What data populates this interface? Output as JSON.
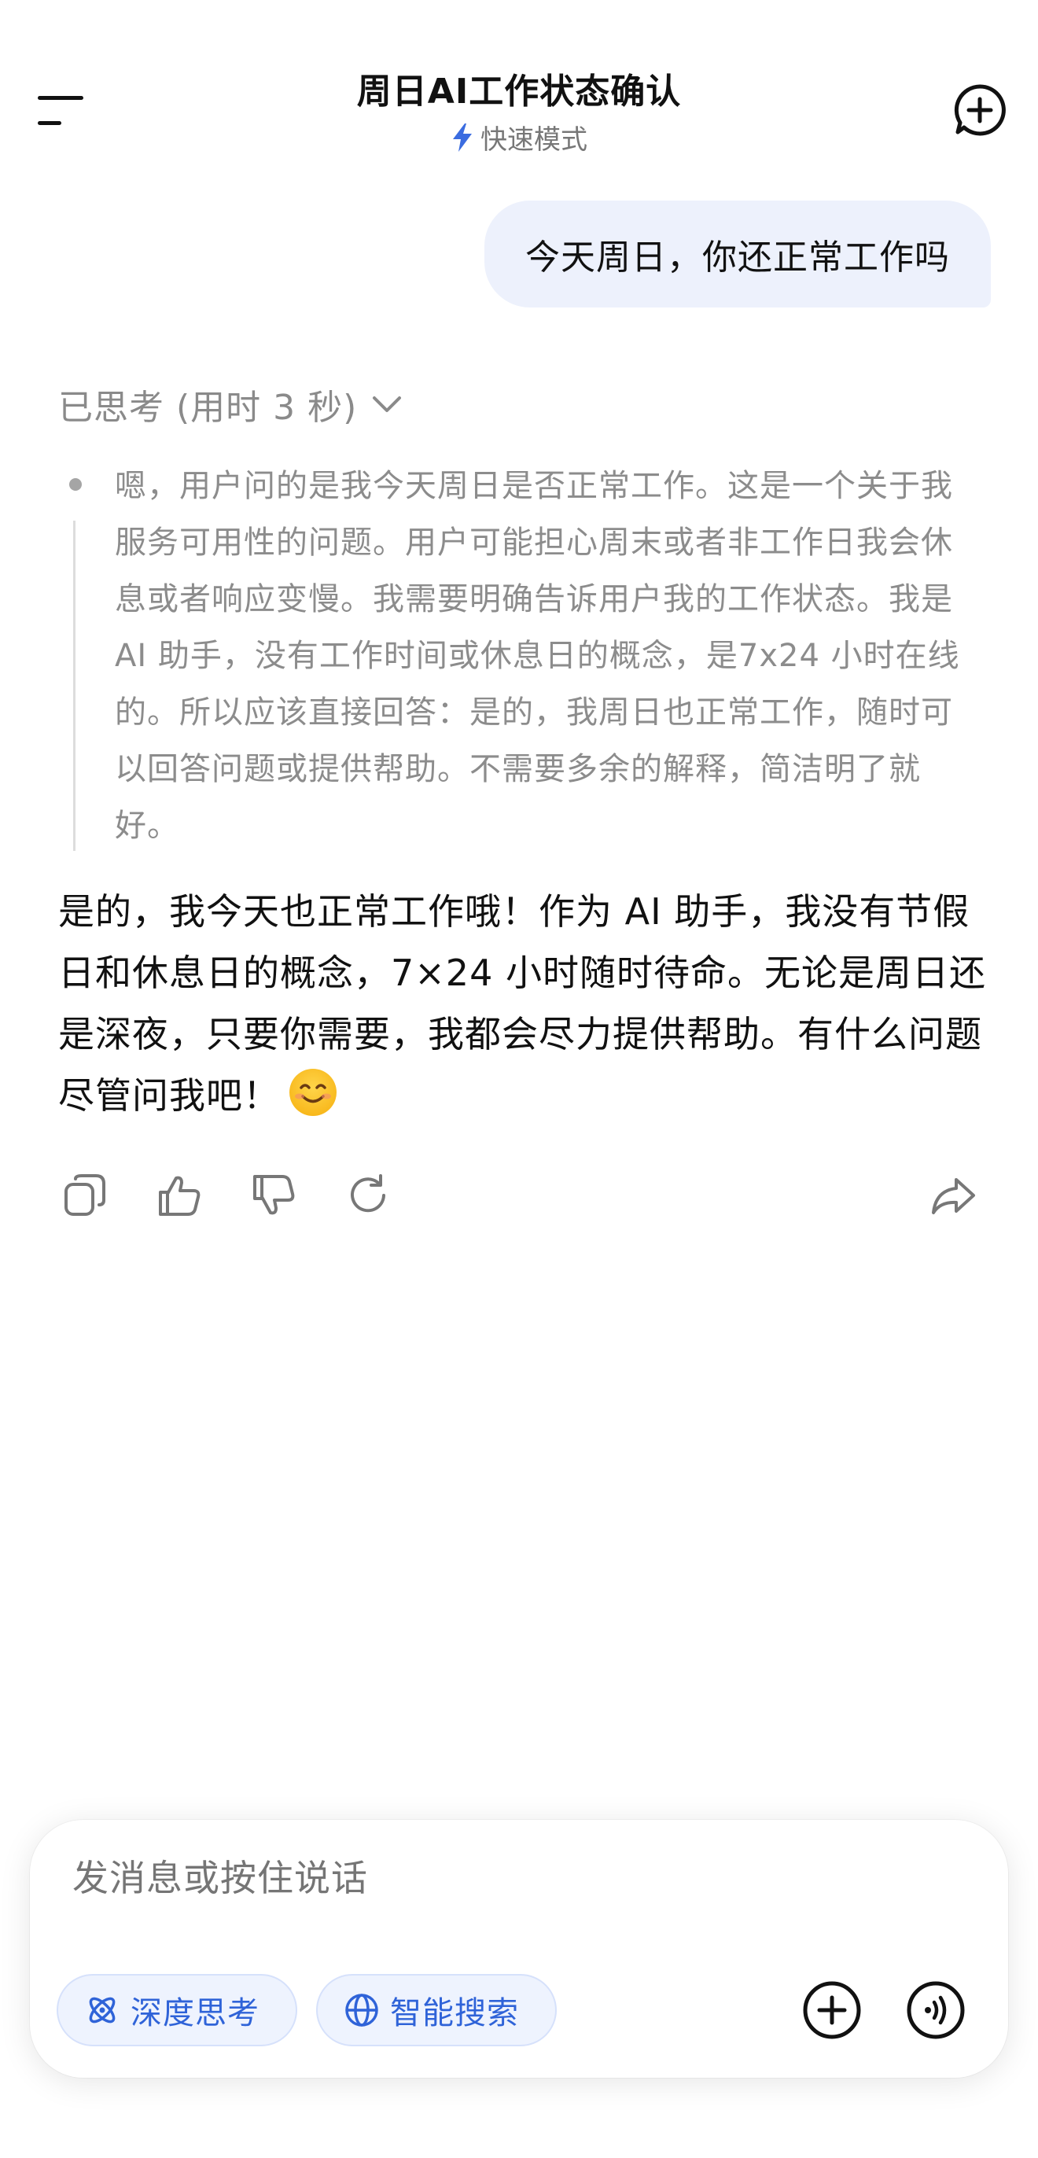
{
  "header": {
    "title": "周日AI工作状态确认",
    "mode_label": "快速模式",
    "menu_icon": "menu-icon",
    "new_chat_icon": "new-chat-icon"
  },
  "messages": {
    "user": "今天周日，你还正常工作吗",
    "thinking_label": "已思考 (用时 3 秒)",
    "thinking_text": "嗯，用户问的是我今天周日是否正常工作。这是一个关于我服务可用性的问题。用户可能担心周末或者非工作日我会休息或者响应变慢。我需要明确告诉用户我的工作状态。我是 AI 助手，没有工作时间或休息日的概念，是7x24 小时在线的。所以应该直接回答：是的，我周日也正常工作，随时可以回答问题或提供帮助。不需要多余的解释，简洁明了就好。",
    "answer": "是的，我今天也正常工作哦！作为 AI 助手，我没有节假日和休息日的概念，7×24 小时随时待命。无论是周日还是深夜，只要你需要，我都会尽力提供帮助。有什么问题尽管问我吧！",
    "emoji": "smiling-face-emoji"
  },
  "actions": [
    "copy-icon",
    "thumbs-up-icon",
    "thumbs-down-icon",
    "regenerate-icon",
    "share-icon"
  ],
  "composer": {
    "placeholder": "发消息或按住说话",
    "chips": {
      "deep_think": "深度思考",
      "smart_search": "智能搜索"
    }
  },
  "colors": {
    "accent": "#2f63d8",
    "user_bubble": "#edf1fc",
    "muted_text": "#8c8c8c",
    "chip_bg": "#eef3fe"
  }
}
